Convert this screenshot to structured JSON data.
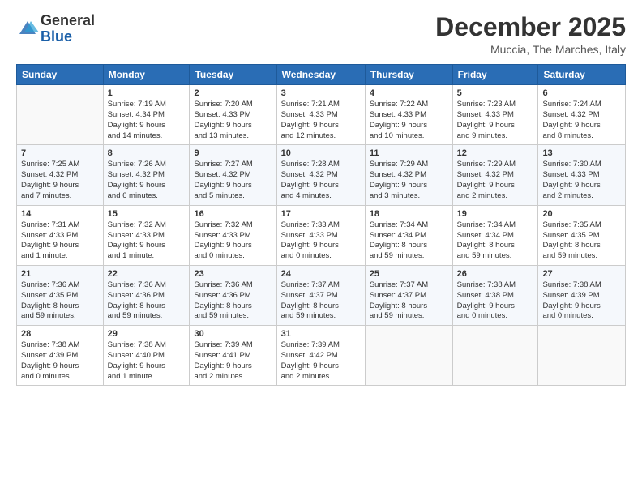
{
  "logo": {
    "general": "General",
    "blue": "Blue"
  },
  "title": "December 2025",
  "location": "Muccia, The Marches, Italy",
  "header_days": [
    "Sunday",
    "Monday",
    "Tuesday",
    "Wednesday",
    "Thursday",
    "Friday",
    "Saturday"
  ],
  "weeks": [
    [
      {
        "day": "",
        "info": ""
      },
      {
        "day": "1",
        "info": "Sunrise: 7:19 AM\nSunset: 4:34 PM\nDaylight: 9 hours\nand 14 minutes."
      },
      {
        "day": "2",
        "info": "Sunrise: 7:20 AM\nSunset: 4:33 PM\nDaylight: 9 hours\nand 13 minutes."
      },
      {
        "day": "3",
        "info": "Sunrise: 7:21 AM\nSunset: 4:33 PM\nDaylight: 9 hours\nand 12 minutes."
      },
      {
        "day": "4",
        "info": "Sunrise: 7:22 AM\nSunset: 4:33 PM\nDaylight: 9 hours\nand 10 minutes."
      },
      {
        "day": "5",
        "info": "Sunrise: 7:23 AM\nSunset: 4:33 PM\nDaylight: 9 hours\nand 9 minutes."
      },
      {
        "day": "6",
        "info": "Sunrise: 7:24 AM\nSunset: 4:32 PM\nDaylight: 9 hours\nand 8 minutes."
      }
    ],
    [
      {
        "day": "7",
        "info": "Sunrise: 7:25 AM\nSunset: 4:32 PM\nDaylight: 9 hours\nand 7 minutes."
      },
      {
        "day": "8",
        "info": "Sunrise: 7:26 AM\nSunset: 4:32 PM\nDaylight: 9 hours\nand 6 minutes."
      },
      {
        "day": "9",
        "info": "Sunrise: 7:27 AM\nSunset: 4:32 PM\nDaylight: 9 hours\nand 5 minutes."
      },
      {
        "day": "10",
        "info": "Sunrise: 7:28 AM\nSunset: 4:32 PM\nDaylight: 9 hours\nand 4 minutes."
      },
      {
        "day": "11",
        "info": "Sunrise: 7:29 AM\nSunset: 4:32 PM\nDaylight: 9 hours\nand 3 minutes."
      },
      {
        "day": "12",
        "info": "Sunrise: 7:29 AM\nSunset: 4:32 PM\nDaylight: 9 hours\nand 2 minutes."
      },
      {
        "day": "13",
        "info": "Sunrise: 7:30 AM\nSunset: 4:33 PM\nDaylight: 9 hours\nand 2 minutes."
      }
    ],
    [
      {
        "day": "14",
        "info": "Sunrise: 7:31 AM\nSunset: 4:33 PM\nDaylight: 9 hours\nand 1 minute."
      },
      {
        "day": "15",
        "info": "Sunrise: 7:32 AM\nSunset: 4:33 PM\nDaylight: 9 hours\nand 1 minute."
      },
      {
        "day": "16",
        "info": "Sunrise: 7:32 AM\nSunset: 4:33 PM\nDaylight: 9 hours\nand 0 minutes."
      },
      {
        "day": "17",
        "info": "Sunrise: 7:33 AM\nSunset: 4:33 PM\nDaylight: 9 hours\nand 0 minutes."
      },
      {
        "day": "18",
        "info": "Sunrise: 7:34 AM\nSunset: 4:34 PM\nDaylight: 8 hours\nand 59 minutes."
      },
      {
        "day": "19",
        "info": "Sunrise: 7:34 AM\nSunset: 4:34 PM\nDaylight: 8 hours\nand 59 minutes."
      },
      {
        "day": "20",
        "info": "Sunrise: 7:35 AM\nSunset: 4:35 PM\nDaylight: 8 hours\nand 59 minutes."
      }
    ],
    [
      {
        "day": "21",
        "info": "Sunrise: 7:36 AM\nSunset: 4:35 PM\nDaylight: 8 hours\nand 59 minutes."
      },
      {
        "day": "22",
        "info": "Sunrise: 7:36 AM\nSunset: 4:36 PM\nDaylight: 8 hours\nand 59 minutes."
      },
      {
        "day": "23",
        "info": "Sunrise: 7:36 AM\nSunset: 4:36 PM\nDaylight: 8 hours\nand 59 minutes."
      },
      {
        "day": "24",
        "info": "Sunrise: 7:37 AM\nSunset: 4:37 PM\nDaylight: 8 hours\nand 59 minutes."
      },
      {
        "day": "25",
        "info": "Sunrise: 7:37 AM\nSunset: 4:37 PM\nDaylight: 8 hours\nand 59 minutes."
      },
      {
        "day": "26",
        "info": "Sunrise: 7:38 AM\nSunset: 4:38 PM\nDaylight: 9 hours\nand 0 minutes."
      },
      {
        "day": "27",
        "info": "Sunrise: 7:38 AM\nSunset: 4:39 PM\nDaylight: 9 hours\nand 0 minutes."
      }
    ],
    [
      {
        "day": "28",
        "info": "Sunrise: 7:38 AM\nSunset: 4:39 PM\nDaylight: 9 hours\nand 0 minutes."
      },
      {
        "day": "29",
        "info": "Sunrise: 7:38 AM\nSunset: 4:40 PM\nDaylight: 9 hours\nand 1 minute."
      },
      {
        "day": "30",
        "info": "Sunrise: 7:39 AM\nSunset: 4:41 PM\nDaylight: 9 hours\nand 2 minutes."
      },
      {
        "day": "31",
        "info": "Sunrise: 7:39 AM\nSunset: 4:42 PM\nDaylight: 9 hours\nand 2 minutes."
      },
      {
        "day": "",
        "info": ""
      },
      {
        "day": "",
        "info": ""
      },
      {
        "day": "",
        "info": ""
      }
    ]
  ]
}
